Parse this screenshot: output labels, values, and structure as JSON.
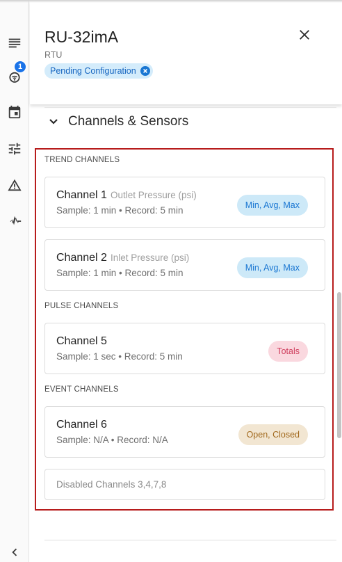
{
  "rail": {
    "items": [
      {
        "name": "list-icon"
      },
      {
        "name": "wifi-icon",
        "badge": "1"
      },
      {
        "name": "calendar-icon"
      },
      {
        "name": "sliders-icon"
      },
      {
        "name": "warning-icon"
      },
      {
        "name": "pulse-icon"
      }
    ],
    "collapse_icon": "chevron-left-icon"
  },
  "header": {
    "title": "RU-32imA",
    "subtitle": "RTU",
    "chip_label": "Pending Configuration",
    "close_icon": "close-icon"
  },
  "section": {
    "title": "Channels & Sensors",
    "expanded": true
  },
  "groups": {
    "trend": "TREND CHANNELS",
    "pulse": "PULSE CHANNELS",
    "event": "EVENT CHANNELS"
  },
  "channels": [
    {
      "name": "Channel 1",
      "sensor": "Outlet Pressure (psi)",
      "meta": "Sample: 1 min • Record: 5 min",
      "pill": "Min, Avg, Max",
      "pill_color": "#cde9f8"
    },
    {
      "name": "Channel 2",
      "sensor": "Inlet Pressure (psi)",
      "meta": "Sample: 1 min • Record: 5 min",
      "pill": "Min, Avg, Max",
      "pill_color": "#cde9f8"
    },
    {
      "name": "Channel 5",
      "sensor": "",
      "meta": "Sample: 1 sec • Record: 5 min",
      "pill": "Totals",
      "pill_color": "#fad8df"
    },
    {
      "name": "Channel 6",
      "sensor": "",
      "meta": "Sample: N/A • Record: N/A",
      "pill": "Open, Closed",
      "pill_color": "#f2e6d2"
    }
  ],
  "disabled_text": "Disabled Channels 3,4,7,8",
  "colors": {
    "accent": "#1976d2",
    "highlight_frame": "#b71c1c",
    "badge": "#1a73e8"
  }
}
